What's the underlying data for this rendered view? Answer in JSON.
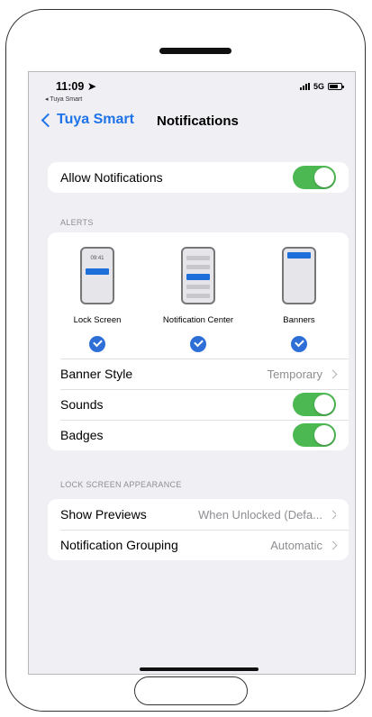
{
  "status_bar": {
    "time": "11:09",
    "back_app": "◂ Tuya Smart",
    "network": "5G"
  },
  "nav": {
    "back_label": "Tuya Smart",
    "title": "Notifications"
  },
  "allow_notifications": {
    "label": "Allow Notifications",
    "enabled": true
  },
  "alerts": {
    "header": "ALERTS",
    "options": [
      {
        "label": "Lock Screen",
        "selected": true,
        "preview_time": "09:41"
      },
      {
        "label": "Notification Center",
        "selected": true
      },
      {
        "label": "Banners",
        "selected": true
      }
    ],
    "banner_style": {
      "label": "Banner Style",
      "value": "Temporary"
    },
    "sounds": {
      "label": "Sounds",
      "enabled": true
    },
    "badges": {
      "label": "Badges",
      "enabled": true
    }
  },
  "lock_screen_appearance": {
    "header": "LOCK SCREEN APPEARANCE",
    "show_previews": {
      "label": "Show Previews",
      "value": "When Unlocked (Defa..."
    },
    "notification_grouping": {
      "label": "Notification Grouping",
      "value": "Automatic"
    }
  },
  "colors": {
    "accent": "#1e73e8",
    "toggle_on": "#4cb852",
    "background": "#efeff4"
  }
}
